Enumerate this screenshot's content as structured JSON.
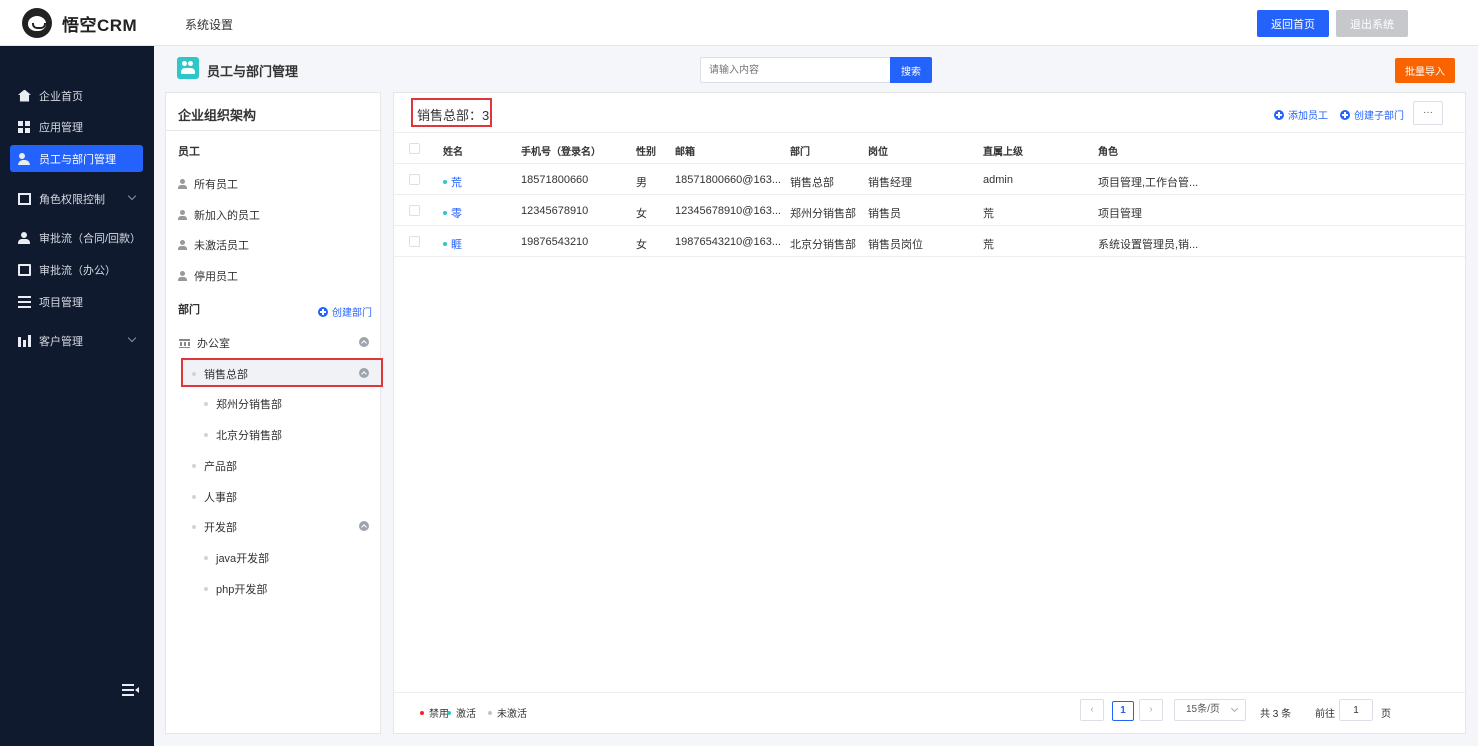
{
  "topbar": {
    "logo_text": "悟空CRM",
    "title": "系统设置",
    "home_button": "返回首页",
    "exit_button": "退出系统"
  },
  "sidebar": {
    "items": [
      {
        "label": "企业首页",
        "icon": "home-icon"
      },
      {
        "label": "应用管理",
        "icon": "grid-icon"
      },
      {
        "label": "员工与部门管理",
        "icon": "users-icon",
        "active": true
      },
      {
        "label": "角色权限控制",
        "icon": "book-icon",
        "has_submenu": true
      },
      {
        "label": "审批流（合同/回款）",
        "icon": "person-icon"
      },
      {
        "label": "审批流（办公）",
        "icon": "monitor-icon"
      },
      {
        "label": "项目管理",
        "icon": "list-icon"
      },
      {
        "label": "客户管理",
        "icon": "chart-icon",
        "has_submenu": true
      }
    ]
  },
  "header": {
    "page_title": "员工与部门管理",
    "search_placeholder": "请输入内容",
    "search_button": "搜索",
    "import_button": "批量导入"
  },
  "org": {
    "title": "企业组织架构",
    "employees_label": "员工",
    "employee_filters": [
      "所有员工",
      "新加入的员工",
      "未激活员工",
      "停用员工"
    ],
    "departments_label": "部门",
    "create_department": "创建部门",
    "tree": [
      {
        "label": "办公室",
        "level": 0,
        "expanded": true
      },
      {
        "label": "销售总部",
        "level": 1,
        "selected": true,
        "expanded": true
      },
      {
        "label": "郑州分销售部",
        "level": 2
      },
      {
        "label": "北京分销售部",
        "level": 2
      },
      {
        "label": "产品部",
        "level": 1
      },
      {
        "label": "人事部",
        "level": 1
      },
      {
        "label": "开发部",
        "level": 1,
        "expanded": true
      },
      {
        "label": "java开发部",
        "level": 2
      },
      {
        "label": "php开发部",
        "level": 2
      }
    ]
  },
  "main": {
    "dept_count": "销售总部：3",
    "add_employee": "添加员工",
    "create_subdept": "创建子部门",
    "more": "···",
    "columns": [
      "姓名",
      "手机号（登录名）",
      "性别",
      "邮箱",
      "部门",
      "岗位",
      "直属上级",
      "角色"
    ],
    "rows": [
      {
        "name": "荒",
        "phone": "18571800660",
        "gender": "男",
        "email": "18571800660@163...",
        "dept": "销售总部",
        "post": "销售经理",
        "leader": "admin",
        "role": "项目管理,工作台管..."
      },
      {
        "name": "零",
        "phone": "12345678910",
        "gender": "女",
        "email": "12345678910@163...",
        "dept": "郑州分销售部",
        "post": "销售员",
        "leader": "荒",
        "role": "项目管理"
      },
      {
        "name": "睚",
        "phone": "19876543210",
        "gender": "女",
        "email": "19876543210@163...",
        "dept": "北京分销售部",
        "post": "销售员岗位",
        "leader": "荒",
        "role": "系统设置管理员,销..."
      }
    ],
    "legend": [
      {
        "label": "禁用",
        "color": "#f5222d"
      },
      {
        "label": "激活",
        "color": "#2ec7c9"
      },
      {
        "label": "未激活",
        "color": "#c0c4cc"
      }
    ],
    "pagination": {
      "current_page": "1",
      "page_size": "15条/页",
      "total": "共 3 条",
      "goto_label": "前往",
      "goto_value": "1",
      "page_unit": "页"
    }
  },
  "colors": {
    "primary": "#2362fb",
    "sidebar_bg": "#101a2e",
    "accent_orange": "#fa6400",
    "highlight_red": "#e0363a",
    "teal": "#2ec7c9"
  }
}
